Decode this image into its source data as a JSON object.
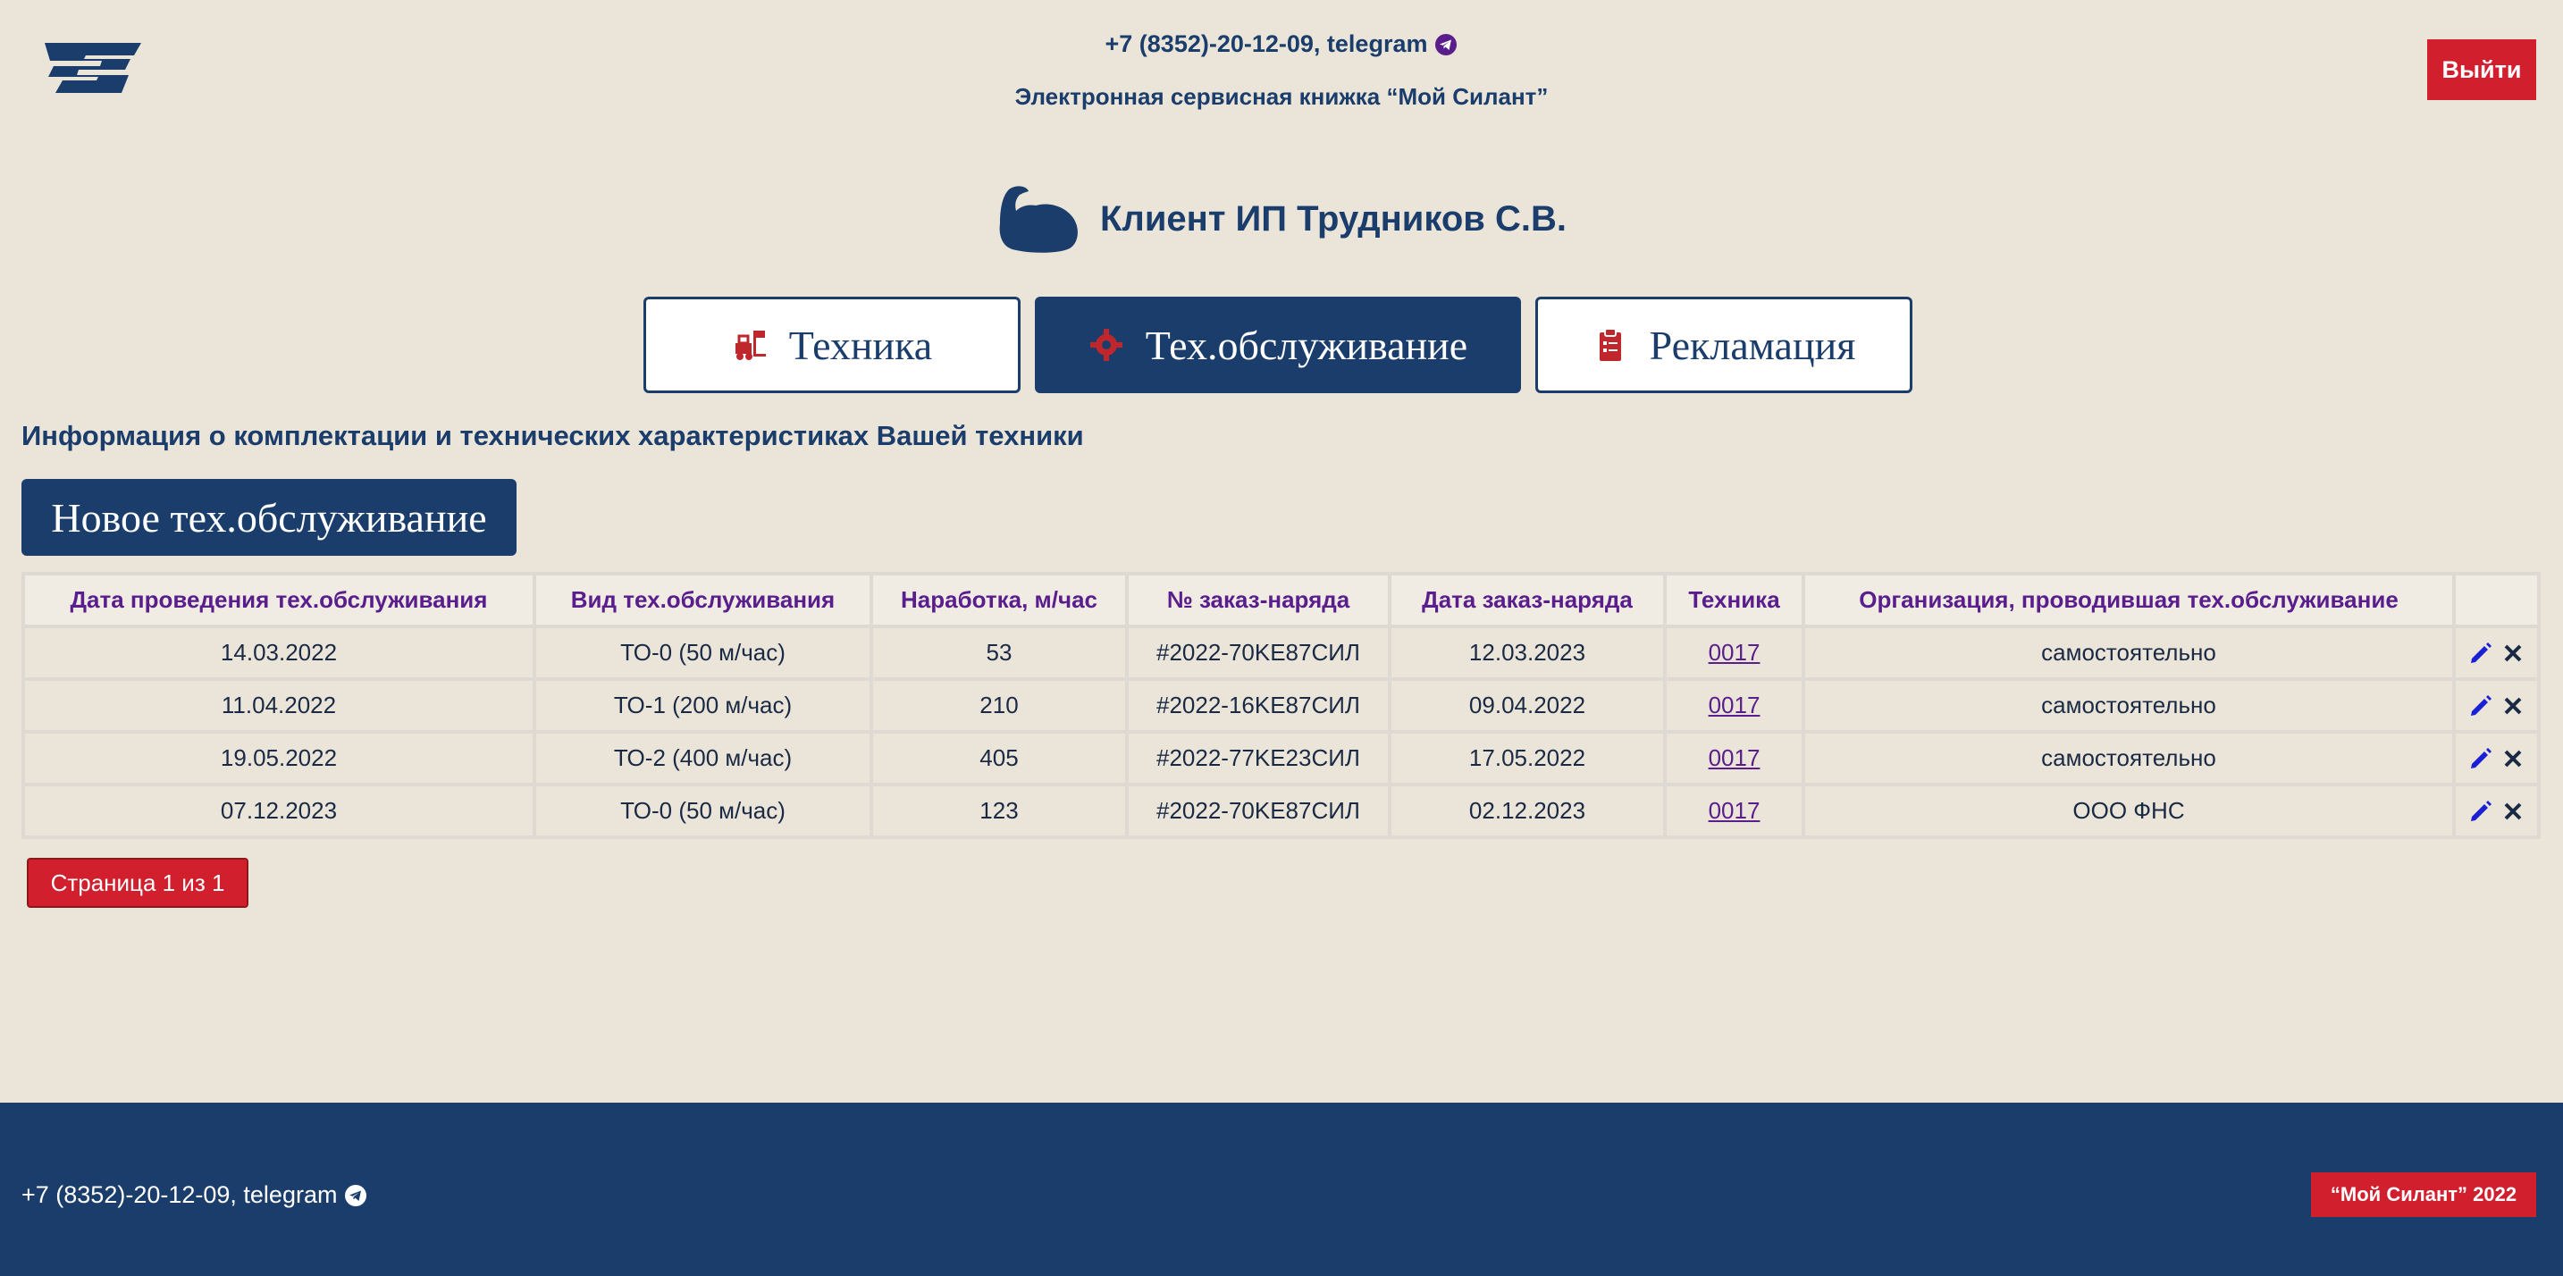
{
  "header": {
    "phone": "+7 (8352)-20-12-09, telegram",
    "subtitle": "Электронная сервисная книжка “Мой Силант”",
    "logout_label": "Выйти"
  },
  "client": {
    "title": "Клиент ИП Трудников С.В."
  },
  "tabs": [
    {
      "label": "Техника",
      "icon": "forklift-icon",
      "active": false
    },
    {
      "label": "Тех.обслуживание",
      "icon": "gear-icon",
      "active": true
    },
    {
      "label": "Рекламация",
      "icon": "clipboard-icon",
      "active": false
    }
  ],
  "section": {
    "title": "Информация о комплектации и технических характеристиках Вашей техники",
    "new_button_label": "Новое тех.обслуживание"
  },
  "table": {
    "headers": [
      "Дата проведения тех.обслуживания",
      "Вид тех.обслуживания",
      "Наработка, м/час",
      "№ заказ-наряда",
      "Дата заказ-наряда",
      "Техника",
      "Организация, проводившая тех.обслуживание",
      ""
    ],
    "rows": [
      [
        "14.03.2022",
        "ТО-0 (50 м/час)",
        "53",
        "#2022-70KE87СИЛ",
        "12.03.2023",
        "0017",
        "самостоятельно"
      ],
      [
        "11.04.2022",
        "ТО-1 (200 м/час)",
        "210",
        "#2022-16KE87СИЛ",
        "09.04.2022",
        "0017",
        "самостоятельно"
      ],
      [
        "19.05.2022",
        "ТО-2 (400 м/час)",
        "405",
        "#2022-77KE23СИЛ",
        "17.05.2022",
        "0017",
        "самостоятельно"
      ],
      [
        "07.12.2023",
        "ТО-0 (50 м/час)",
        "123",
        "#2022-70KE87СИЛ",
        "02.12.2023",
        "0017",
        "ООО ФНС"
      ]
    ],
    "row_actions": [
      "edit-icon",
      "delete-icon"
    ]
  },
  "pagination": {
    "label": "Страница 1 из 1"
  },
  "footer": {
    "phone": "+7 (8352)-20-12-09, telegram",
    "brand": "“Мой Силант” 2022"
  },
  "colors": {
    "background": "#ebe5d9",
    "primary": "#1a3d6b",
    "accent": "#d21f2d",
    "header_text": "#5a1e8c"
  }
}
